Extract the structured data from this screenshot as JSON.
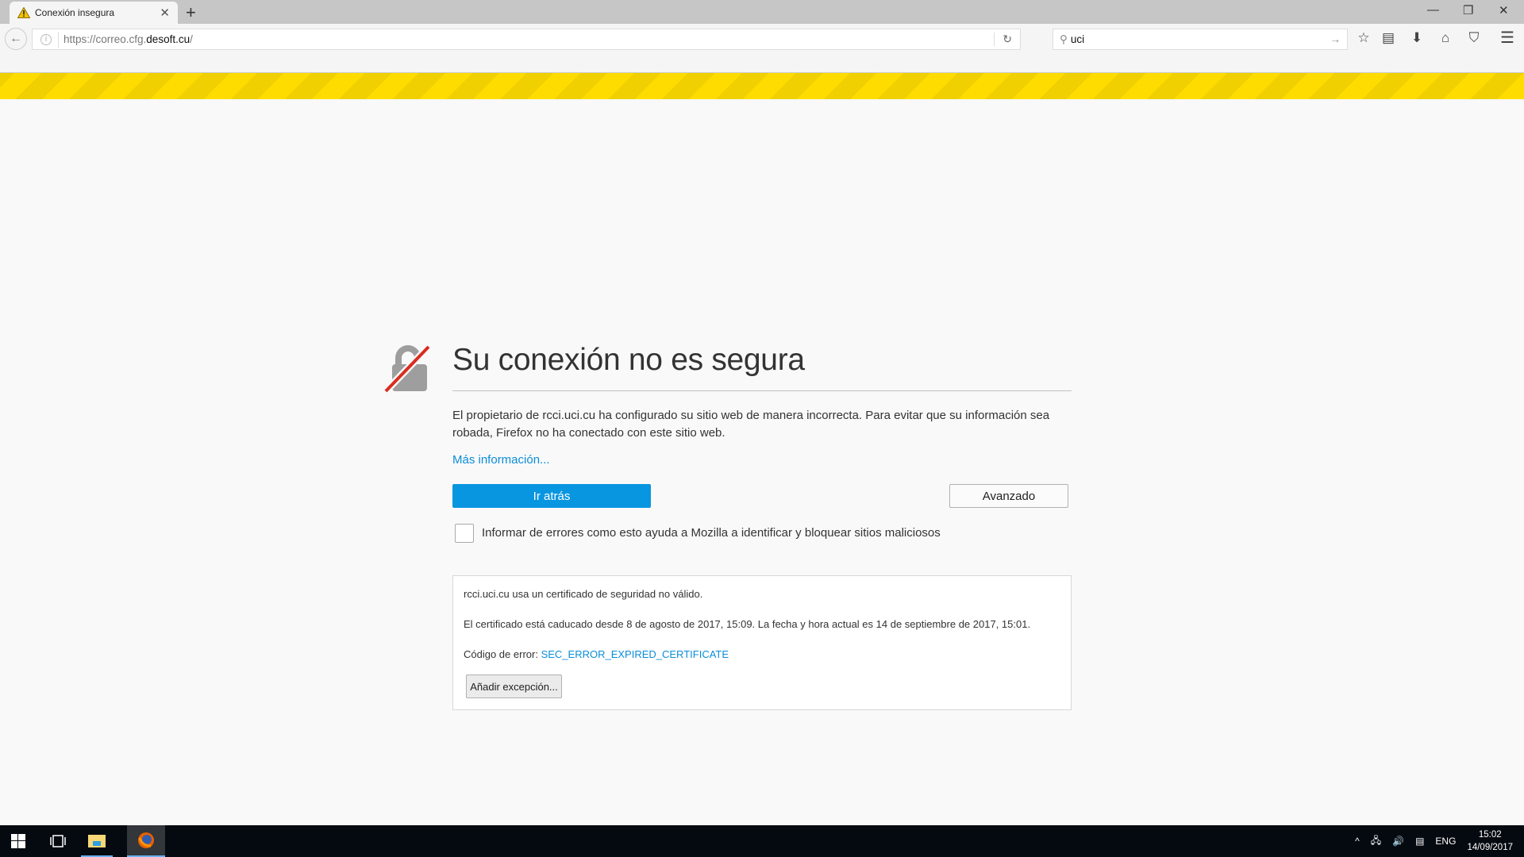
{
  "browser": {
    "tab": {
      "title": "Conexión insegura",
      "icon": "warning-icon"
    },
    "url": {
      "prefix": "https://correo.cfg.",
      "host": "desoft.cu",
      "suffix": "/"
    },
    "search": {
      "value": "uci"
    }
  },
  "page": {
    "title": "Su conexión no es segura",
    "description": "El propietario de rcci.uci.cu ha configurado su sitio web de manera incorrecta. Para evitar que su información sea robada, Firefox no ha conectado con este sitio web.",
    "more_info": "Más información...",
    "go_back": "Ir atrás",
    "advanced": "Avanzado",
    "report_label": "Informar de errores como esto ayuda a Mozilla a identificar y bloquear sitios maliciosos",
    "report_checked": false,
    "details": {
      "line1": "rcci.uci.cu usa un certificado de seguridad no válido.",
      "line2": "El certificado está caducado desde 8 de agosto de 2017, 15:09. La fecha y hora actual es 14 de septiembre de 2017, 15:01.",
      "code_label": "Código de error: ",
      "code": "SEC_ERROR_EXPIRED_CERTIFICATE",
      "add_exception": "Añadir excepción..."
    },
    "colors": {
      "primary": "#0996e0",
      "link": "#0a8dd8",
      "stripe": "#ffdc00"
    }
  },
  "taskbar": {
    "lang": "ENG",
    "time": "15:02",
    "date": "14/09/2017"
  }
}
